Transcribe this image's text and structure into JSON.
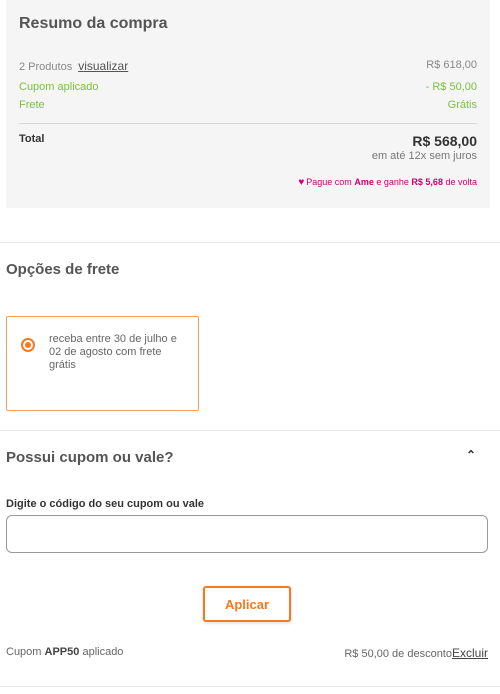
{
  "summary": {
    "title": "Resumo da compra",
    "products_label": "2 Produtos",
    "view_link": "visualizar",
    "products_value": "R$ 618,00",
    "coupon_label": "Cupom aplicado",
    "coupon_value": "- R$ 50,00",
    "shipping_label": "Frete",
    "shipping_value": "Grátis",
    "total_label": "Total",
    "total_value": "R$ 568,00",
    "installments": "em até 12x sem juros",
    "ame_prefix": "Pague com",
    "ame_brand": "Ame",
    "ame_middle": "e ganhe",
    "ame_amount": "R$ 5,68",
    "ame_suffix": "de volta"
  },
  "shipping": {
    "title": "Opções de frete",
    "option_text": "receba entre 30 de julho e 02 de agosto com frete grátis"
  },
  "coupon": {
    "title": "Possui cupom ou vale?",
    "field_label": "Digite o código do seu cupom ou vale",
    "input_value": "",
    "apply_button": "Aplicar",
    "applied_prefix": "Cupom",
    "applied_code": "APP50",
    "applied_suffix": "aplicado",
    "discount_text": "R$ 50,00 de desconto",
    "remove_link": "Excluir"
  },
  "colors": {
    "accent": "#f47920",
    "green": "#7ac143",
    "ame": "#d0006f"
  },
  "icons": {
    "heart": "heart-icon",
    "chevron": "chevron-up-icon",
    "radio": "radio-selected-icon"
  }
}
